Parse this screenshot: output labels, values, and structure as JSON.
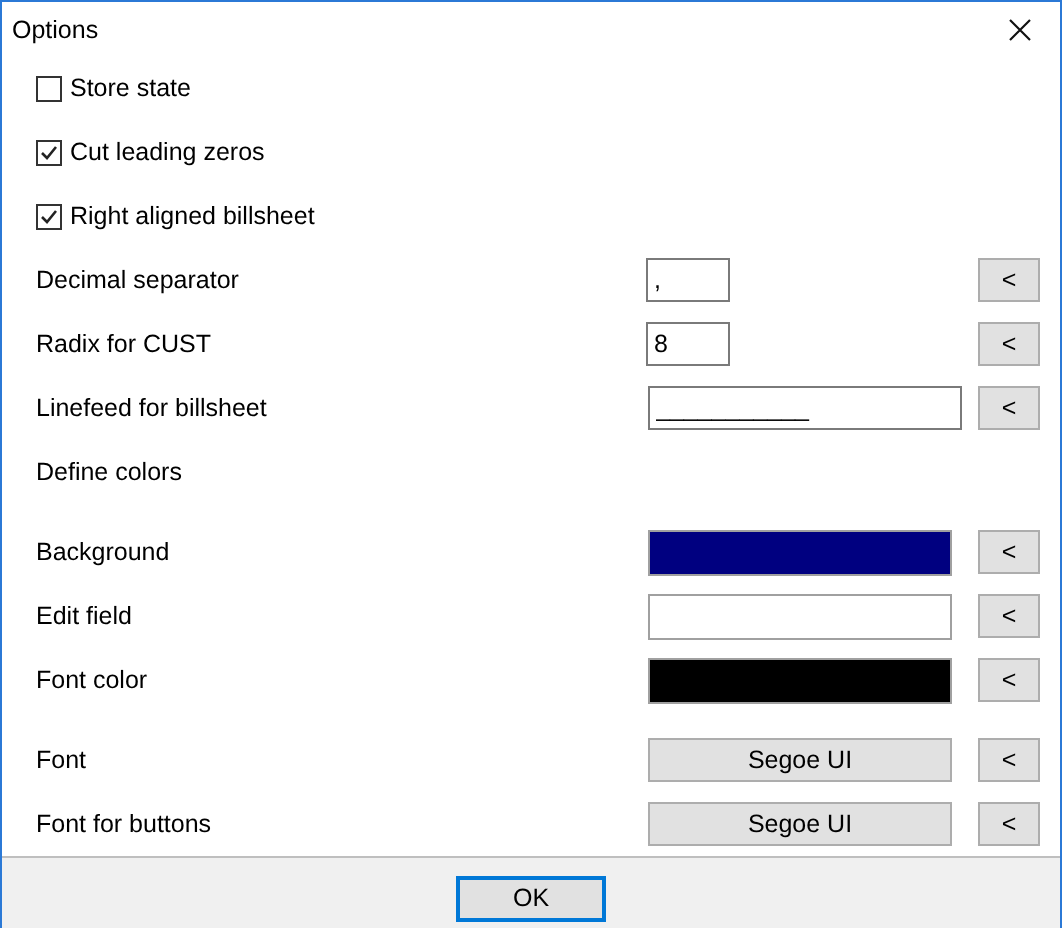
{
  "window": {
    "title": "Options"
  },
  "options": [
    {
      "kind": "checkbox",
      "label": "Store state",
      "checked": false
    },
    {
      "kind": "checkbox",
      "label": "Cut leading zeros",
      "checked": true
    },
    {
      "kind": "checkbox",
      "label": "Right aligned billsheet",
      "checked": true
    },
    {
      "kind": "short-field",
      "label": "Decimal separator",
      "value": ",",
      "button": "<"
    },
    {
      "kind": "short-field",
      "label": "Radix for CUST",
      "value": "8",
      "button": "<"
    },
    {
      "kind": "long-field",
      "label": "Linefeed for billsheet",
      "value": "___________",
      "button": "<"
    },
    {
      "kind": "heading",
      "label": "Define colors"
    },
    {
      "kind": "color",
      "label": "Background",
      "color": "#000080",
      "button": "<"
    },
    {
      "kind": "color",
      "label": "Edit field",
      "color": "#ffffff",
      "button": "<"
    },
    {
      "kind": "color",
      "label": "Font color",
      "color": "#000000",
      "button": "<"
    },
    {
      "kind": "font",
      "label": "Font",
      "value": "Segoe UI",
      "button": "<"
    },
    {
      "kind": "font",
      "label": "Font for buttons",
      "value": "Segoe UI",
      "button": "<"
    }
  ],
  "footer": {
    "ok_button": "OK"
  }
}
